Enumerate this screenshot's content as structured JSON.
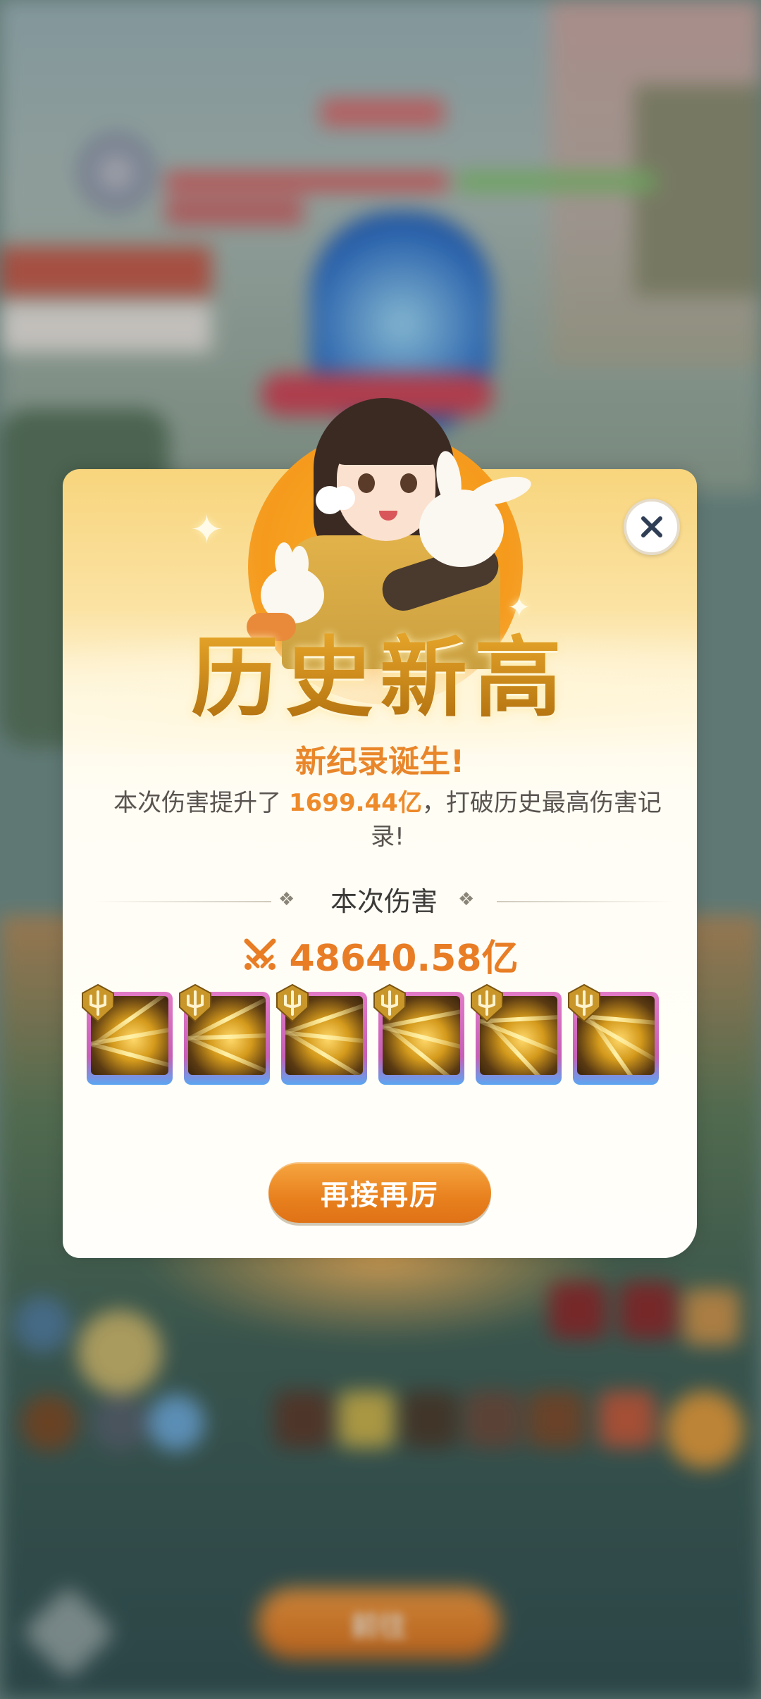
{
  "dialog": {
    "title": "历史新高",
    "subtitle": "新纪录诞生!",
    "desc_prefix": "本次伤害提升了 ",
    "desc_value": "1699.44亿",
    "desc_suffix": "，打破历史最高伤害记录!",
    "section_label": "本次伤害",
    "damage_value": "48640.58亿",
    "action_label": "再接再厉",
    "skills": [
      {
        "name": "golden-spears"
      },
      {
        "name": "golden-wheel"
      },
      {
        "name": "golden-beam"
      },
      {
        "name": "golden-dragon"
      },
      {
        "name": "golden-phoenix"
      },
      {
        "name": "golden-spirit"
      }
    ]
  },
  "colors": {
    "accent_orange": "#e87d25",
    "title_gold": "#c98a17",
    "skill_frame_pink": "#e27bc7"
  }
}
